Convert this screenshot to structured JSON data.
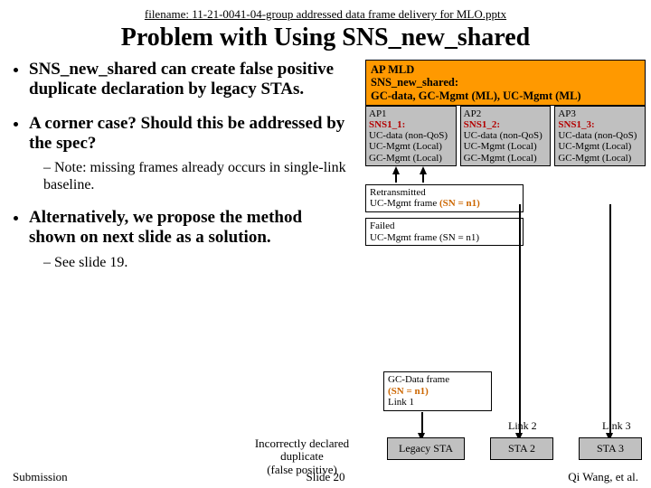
{
  "header": {
    "filename_label": "filename:",
    "filename_value": "11-21-0041-04-group addressed data frame delivery for MLO.pptx"
  },
  "title": "Problem with Using SNS_new_shared",
  "bullets": {
    "b1": "SNS_new_shared can create false positive duplicate declaration by legacy STAs.",
    "b2": "A corner case? Should this be addressed by the spec?",
    "b2_sub": "Note: missing frames already occurs in single-link baseline.",
    "b3": "Alternatively, we propose the method shown on next slide as a solution.",
    "b3_sub": "See slide 19."
  },
  "apmld": {
    "line1": "AP MLD",
    "line2a": "SNS_new_shared:",
    "line3": "GC-data, GC-Mgmt (ML), UC-Mgmt (ML)"
  },
  "aps": [
    {
      "num": "AP1",
      "sns": "SNS1_1:",
      "rest": "UC-data (non-QoS)\nUC-Mgmt (Local)\nGC-Mgmt (Local)"
    },
    {
      "num": "AP2",
      "sns": "SNS1_2:",
      "rest": "UC-data (non-QoS)\nUC-Mgmt (Local)\nGC-Mgmt (Local)"
    },
    {
      "num": "AP3",
      "sns": "SNS1_3:",
      "rest": "UC-data (non-QoS)\nUC-Mgmt (Local)\nGC-Mgmt (Local)"
    }
  ],
  "retrans": {
    "t1": "Retransmitted",
    "t2": "UC-Mgmt frame ",
    "sn": "(SN = n1)"
  },
  "failed": {
    "t1": "Failed",
    "t2": "UC-Mgmt frame ",
    "sn": "(SN = n1)"
  },
  "gcdata": {
    "t1": "GC-Data frame",
    "sn": "(SN = n1)",
    "t3": "Link 1"
  },
  "links": {
    "l2": "Link 2",
    "l3": "Link 3"
  },
  "stas": {
    "s1": "Legacy STA",
    "s2": "STA 2",
    "s3": "STA 3"
  },
  "falsepos": {
    "l1": "Incorrectly declared",
    "l2": "duplicate",
    "l3": "(false positive)"
  },
  "footer": {
    "left": "Submission",
    "mid": "Slide 20",
    "right": "Qi Wang, et al."
  }
}
